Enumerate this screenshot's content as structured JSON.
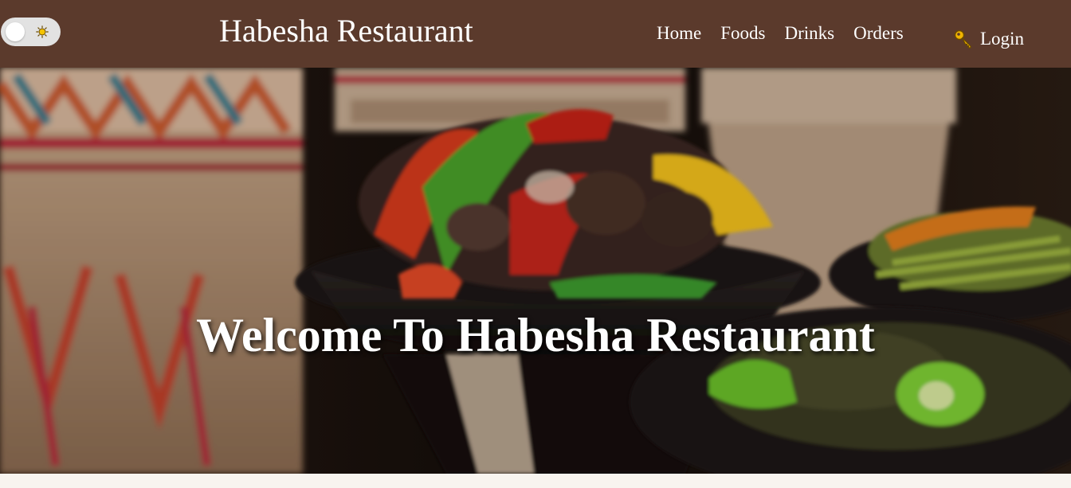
{
  "header": {
    "brand": "Habesha Restaurant",
    "nav": [
      "Home",
      "Foods",
      "Drinks",
      "Orders"
    ],
    "login_label": "Login",
    "theme_toggle": {
      "mode": "light",
      "icon": "sun-icon"
    },
    "login_icon": "key-icon",
    "colors": {
      "bar": "#5b3a2c",
      "text": "#ffffff",
      "toggle_bg": "#e2e2e2",
      "sun": "#f5c400"
    }
  },
  "hero": {
    "title": "Welcome To Habesha Restaurant",
    "image_subject": "food-photo"
  }
}
